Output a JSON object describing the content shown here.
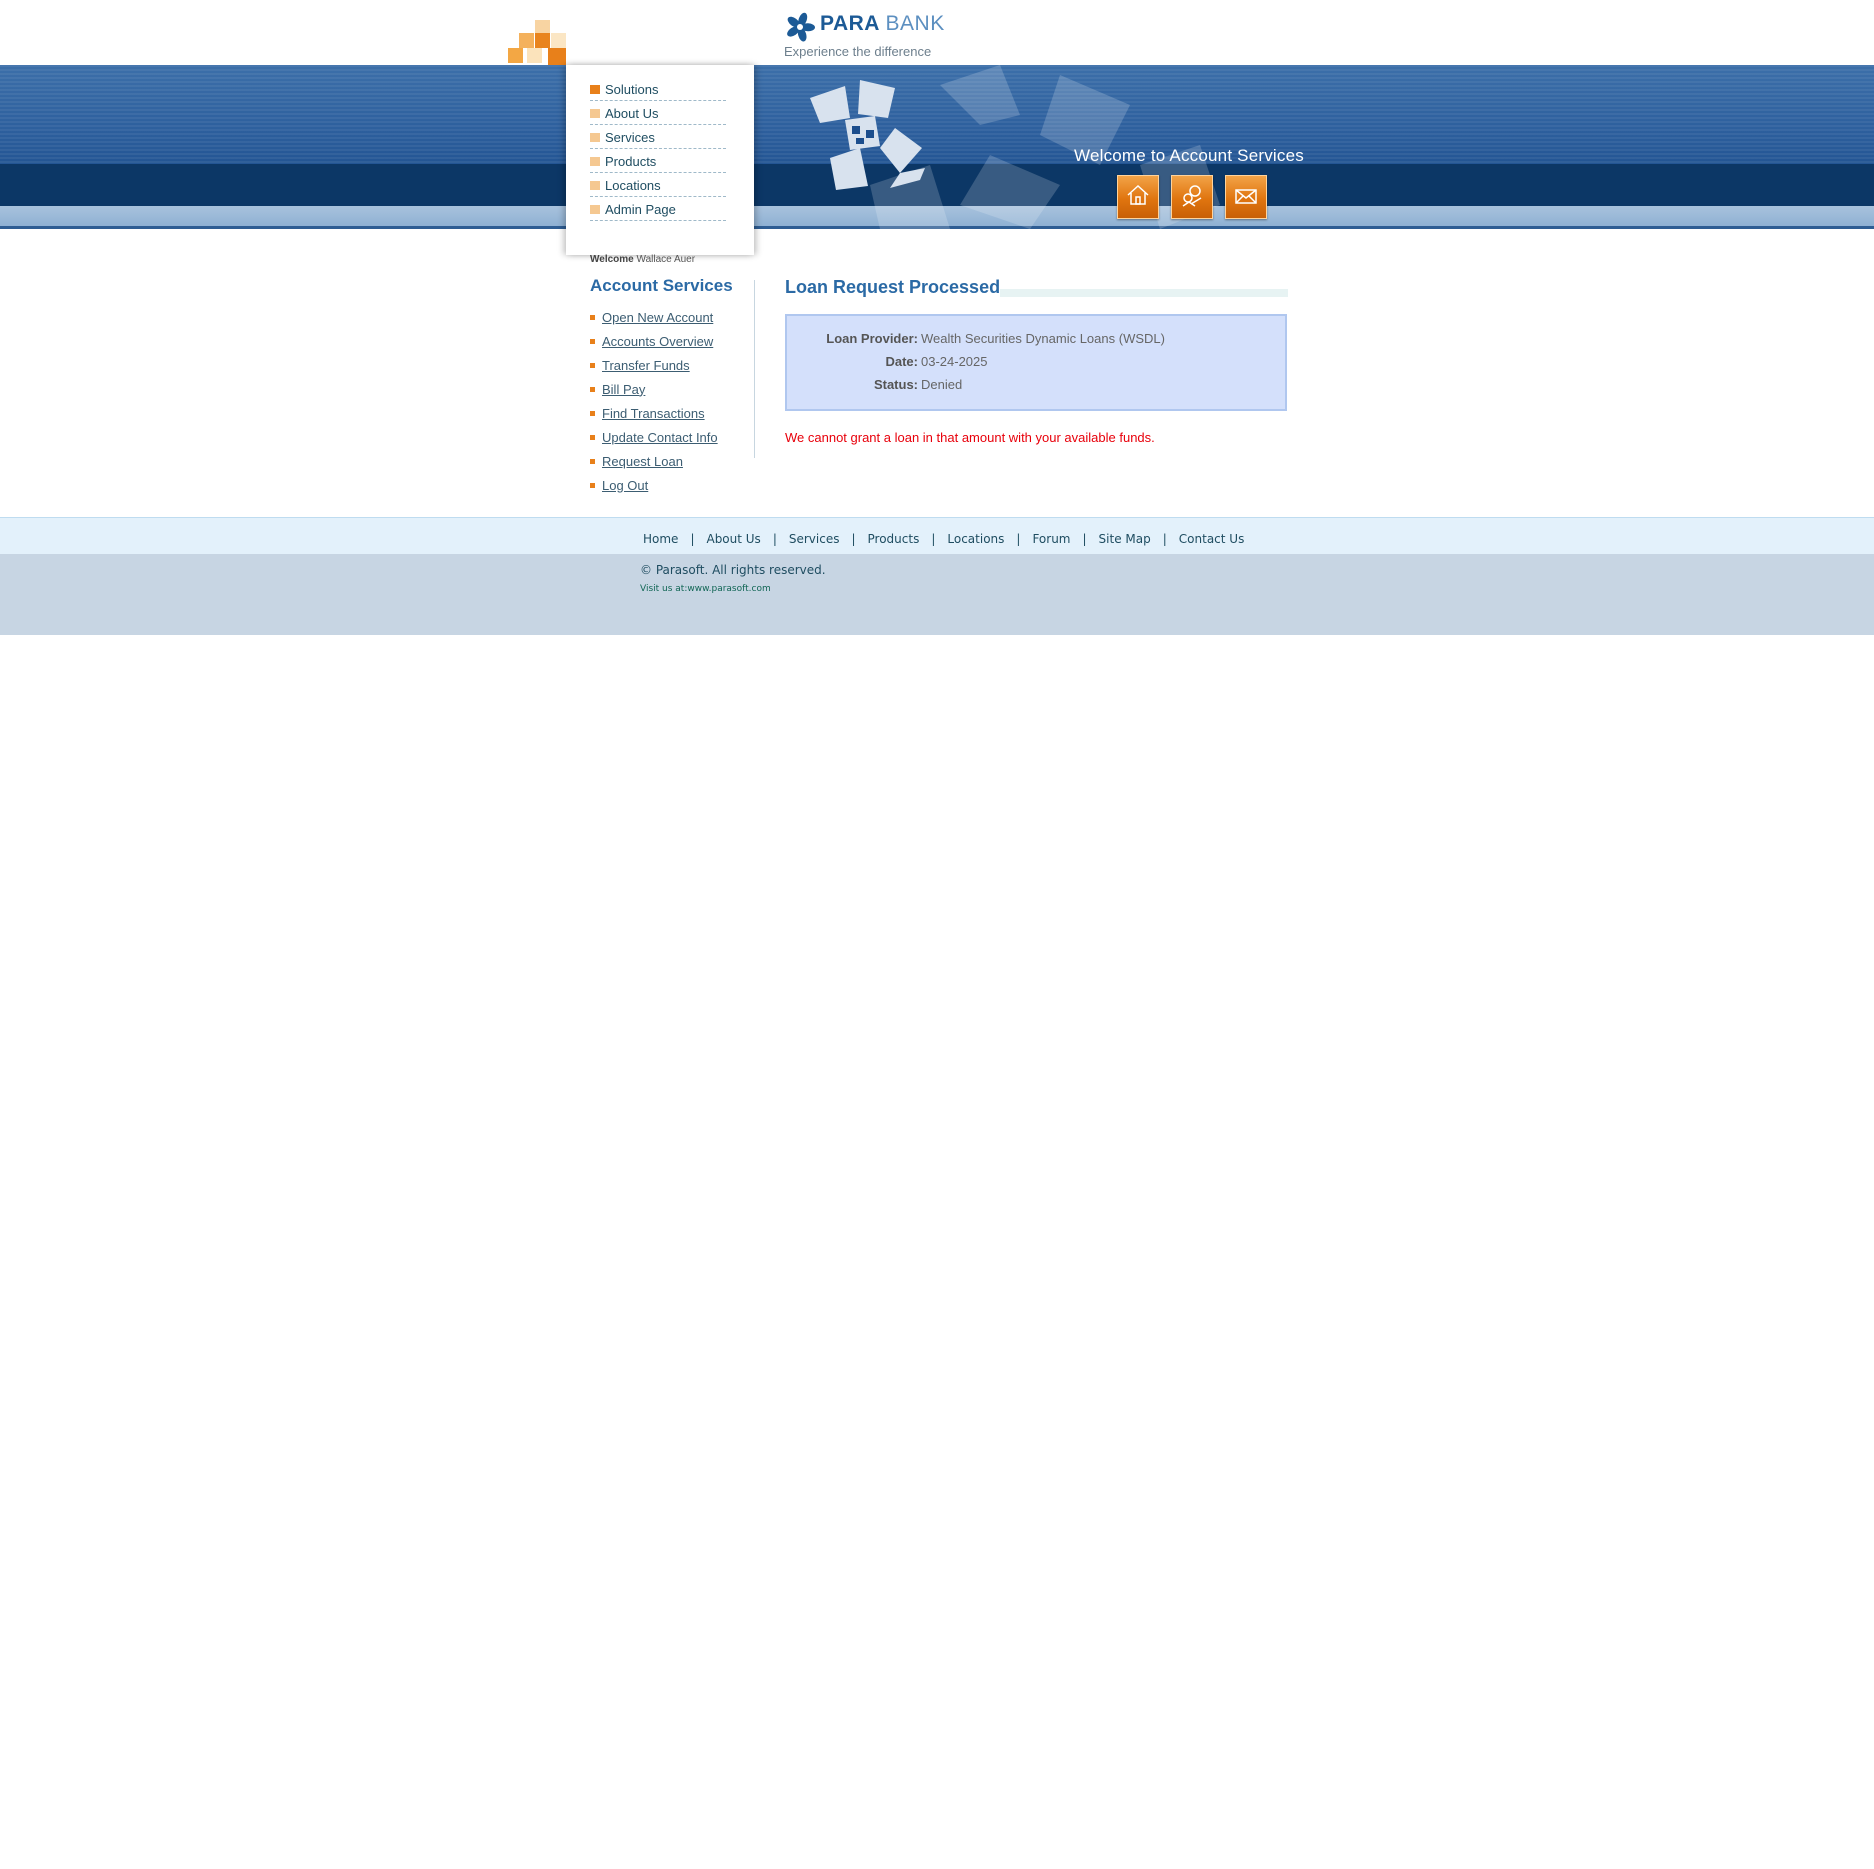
{
  "brand": {
    "name_part1": "PARA",
    "name_part2": "BANK",
    "tagline": "Experience the difference"
  },
  "header": {
    "nav": [
      "Solutions",
      "About Us",
      "Services",
      "Products",
      "Locations",
      "Admin Page"
    ],
    "welcome_banner": "Welcome to Account Services",
    "icons": [
      "home-icon",
      "about-icon",
      "contact-icon"
    ]
  },
  "sidebar": {
    "welcome_label": "Welcome",
    "user_name": "Wallace Auer",
    "title": "Account Services",
    "links": [
      "Open New Account",
      "Accounts Overview",
      "Transfer Funds",
      "Bill Pay",
      "Find Transactions",
      "Update Contact Info",
      "Request Loan",
      "Log Out"
    ]
  },
  "main": {
    "title": "Loan Request Processed",
    "rows": [
      {
        "label": "Loan Provider:",
        "value": "Wealth Securities Dynamic Loans (WSDL)"
      },
      {
        "label": "Date:",
        "value": "03-24-2025"
      },
      {
        "label": "Status:",
        "value": "Denied"
      }
    ],
    "error": "We cannot grant a loan in that amount with your available funds."
  },
  "footer": {
    "links": [
      "Home",
      "About Us",
      "Services",
      "Products",
      "Locations",
      "Forum",
      "Site Map",
      "Contact Us"
    ],
    "separator": "|",
    "copyright": "© Parasoft. All rights reserved.",
    "visit": "Visit us at:www.parasoft.com"
  },
  "colors": {
    "accent_blue": "#2b6aa5",
    "accent_orange": "#e8801a",
    "error_red": "#e8000b"
  }
}
